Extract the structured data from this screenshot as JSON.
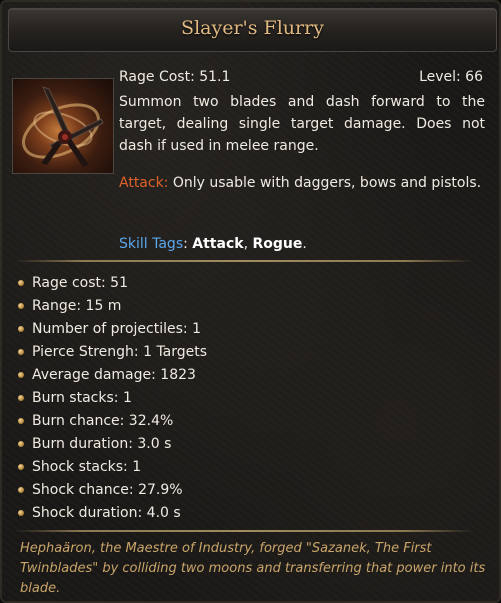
{
  "tooltip": {
    "title": "Slayer's Flurry",
    "rage_cost": "Rage Cost: 51.1",
    "level": "Level: 66",
    "description": "Summon two blades and dash forward to the target, dealing single target damage. Does not dash if used in melee range.",
    "attack_label": "Attack:",
    "attack_text": " Only usable with daggers, bows and pistols.",
    "skill_tags_label": "Skill Tags",
    "skill_tags_colon": ": ",
    "tag_1": "Attack",
    "tag_sep": ", ",
    "tag_2": "Rogue",
    "tag_end": ".",
    "icon": "crossed-blades-icon"
  },
  "stats": [
    "Rage cost: 51",
    "Range: 15 m",
    "Number of projectiles: 1",
    "Pierce Strengh: 1 Targets",
    "Average damage: 1823",
    "Burn stacks: 1",
    "Burn chance: 32.4%",
    "Burn duration: 3.0 s",
    "Shock stacks: 1",
    "Shock chance: 27.9%",
    "Shock duration: 4.0 s"
  ],
  "lore": "Hephaäron, the Maestre of Industry, forged \"Sazanek, The First Twinblades\" by colliding two moons and transferring that power into its blade.",
  "colors": {
    "title": "#e2b982",
    "attack_label": "#e0612a",
    "tag_label": "#5aa7ec",
    "lore": "#c9a56a",
    "text": "#f0ebe2"
  }
}
